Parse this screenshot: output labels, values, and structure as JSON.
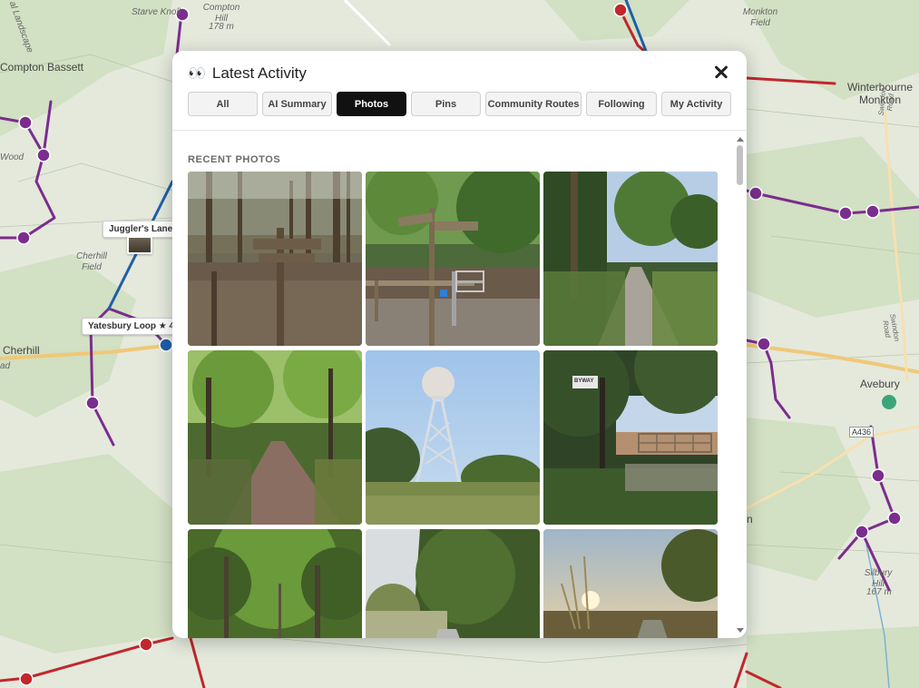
{
  "map": {
    "labels": {
      "starve_knoll": "Starve Knoll",
      "compton_hill": "Compton Hill",
      "compton_hill_elev": "178 m",
      "compton_bassett": "Compton Bassett",
      "wood": "Wood",
      "landscape": "al Landscape",
      "cherhill_field": "Cherhill Field",
      "cherhill": "Cherhill",
      "ad": "ad",
      "monkton_field": "Monkton Field",
      "winterbourne_monkton": "Winterbourne Monkton",
      "swindon_road_a": "Swindon Road",
      "swindon_road_b": "Swindon Road",
      "avebury": "Avebury",
      "a4361": "A436",
      "silbury_hill": "Silbury Hill",
      "silbury_hill_elev": "167 m",
      "n": "n"
    },
    "route_chips": {
      "jugglers_lane": "Juggler's Lane",
      "yatesbury_loop": "Yatesbury Loop  ★ 4"
    },
    "colors": {
      "route_purple": "#7b2d8e",
      "route_blue": "#1f5fa8",
      "route_red": "#c1272d"
    }
  },
  "modal": {
    "title_icon": "eyes-emoji",
    "title_emoji": "👀",
    "title": "Latest Activity",
    "close_icon": "close-icon",
    "tabs": [
      {
        "label": "All",
        "active": false
      },
      {
        "label": "AI Summary",
        "active": false
      },
      {
        "label": "Photos",
        "active": true
      },
      {
        "label": "Pins",
        "active": false
      },
      {
        "label": "Community Routes",
        "active": false
      },
      {
        "label": "Following",
        "active": false
      },
      {
        "label": "My Activity",
        "active": false
      }
    ],
    "section_label": "RECENT PHOTOS",
    "photos": [
      {
        "subject": "woodland signpost"
      },
      {
        "subject": "fingerpost and gate in forest"
      },
      {
        "subject": "gravel track through trees"
      },
      {
        "subject": "sunlit woodland path"
      },
      {
        "subject": "radar tower under blue sky"
      },
      {
        "subject": "byway sign and field gate"
      },
      {
        "subject": "tree tunnel"
      },
      {
        "subject": "path into conifers"
      },
      {
        "subject": "sunset over grassy track"
      }
    ],
    "byway_sign": "BYWAY"
  }
}
